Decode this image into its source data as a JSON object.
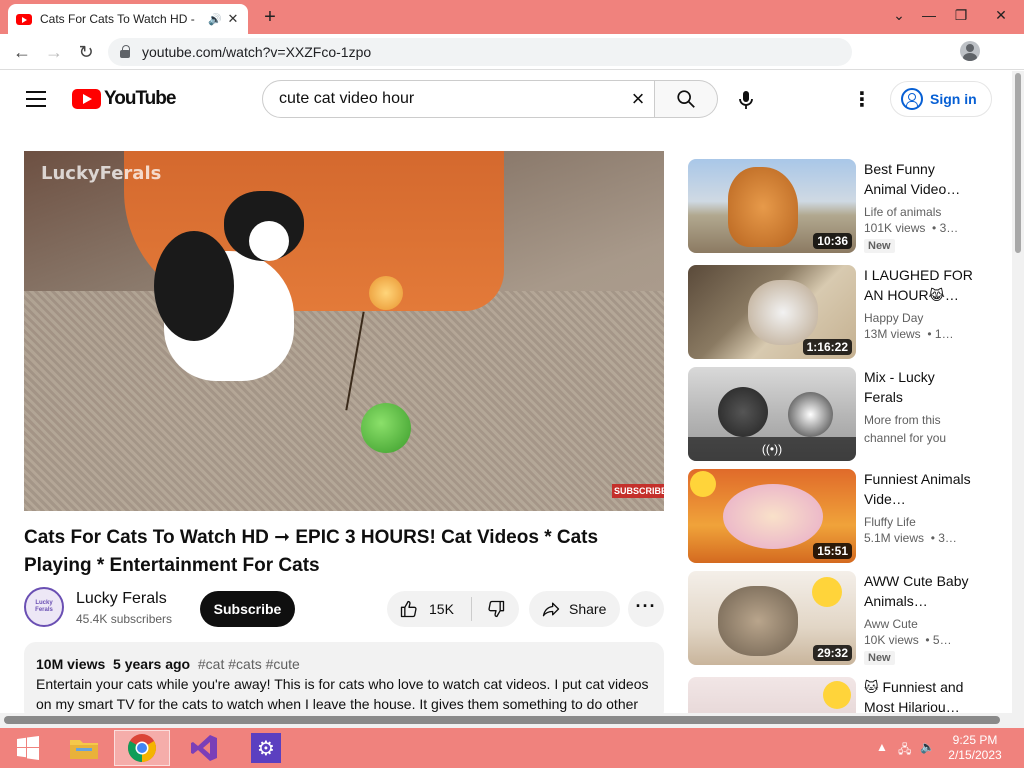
{
  "browser": {
    "tab_title": "Cats For Cats To Watch HD -",
    "url": "youtube.com/watch?v=XXZFco-1zpo"
  },
  "youtube": {
    "logo_text": "YouTube",
    "search_value": "cute cat video hour",
    "signin_label": "Sign in"
  },
  "video": {
    "watermark": "LuckyFerals",
    "subscribe_watermark": "SUBSCRIBE",
    "title": "Cats For Cats To Watch HD ➞ EPIC 3 HOURS! Cat Videos * Cats Playing * Entertainment For Cats",
    "channel": "Lucky Ferals",
    "avatar_text": "Lucky Ferals",
    "subscribers": "45.4K subscribers",
    "subscribe_label": "Subscribe",
    "likes": "15K",
    "share_label": "Share",
    "views": "10M views",
    "age": "5 years ago",
    "tags": "#cat #cats #cute",
    "description": "Entertain your cats while you're away! This is for cats who love to watch cat videos. I put cat videos on my smart TV for the cats to watch when I leave the house. It gives them something to do other"
  },
  "sidebar": [
    {
      "title": "Best Funny Animal Video…",
      "channel": "Life of animals",
      "views": "101K views",
      "age": "• 3…",
      "duration": "10:36",
      "badge": "New"
    },
    {
      "title": "I LAUGHED FOR AN HOUR😹…",
      "channel": "Happy Day",
      "views": "13M views",
      "age": "• 1…",
      "duration": "1:16:22"
    },
    {
      "title": "Mix - Lucky Ferals",
      "channel": "More from this channel for you",
      "mix_icon": "((•))"
    },
    {
      "title": "Funniest Animals Vide…",
      "channel": "Fluffy Life",
      "views": "5.1M views",
      "age": "• 3…",
      "duration": "15:51"
    },
    {
      "title": "AWW Cute Baby Animals…",
      "channel": "Aww Cute",
      "views": "10K views",
      "age": "• 5…",
      "duration": "29:32",
      "badge": "New"
    },
    {
      "title": "🐱 Funniest and Most Hilariou…"
    }
  ],
  "taskbar": {
    "time": "9:25 PM",
    "date": "2/15/2023"
  }
}
